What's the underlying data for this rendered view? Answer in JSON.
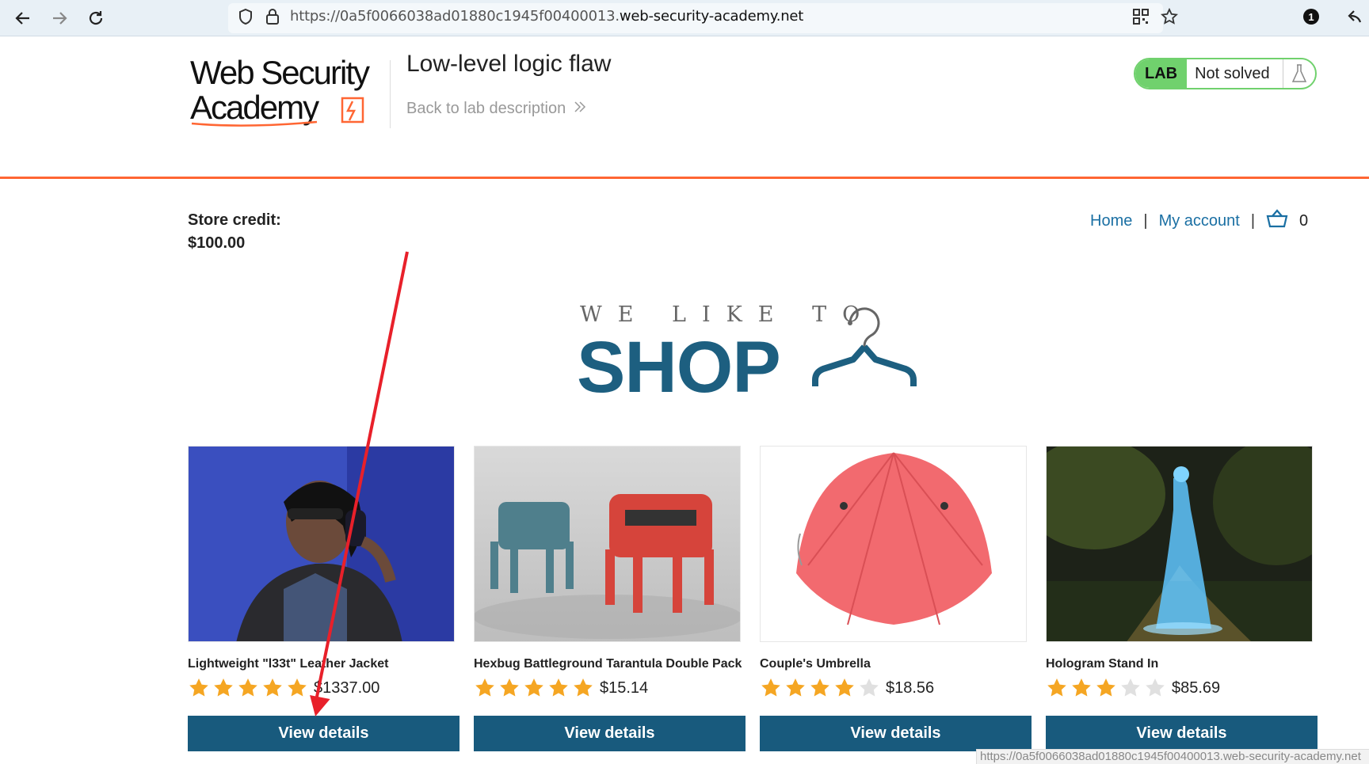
{
  "browser": {
    "url_prefix": "https://0a5f0066038ad01880c1945f00400013.",
    "url_host": "web-security-academy.net",
    "notification_count": "1"
  },
  "lab": {
    "logo_line1": "Web Security",
    "logo_line2": "Academy",
    "title": "Low-level logic flaw",
    "back_link": "Back to lab description",
    "badge": "LAB",
    "status": "Not solved"
  },
  "store": {
    "credit_label": "Store credit:",
    "credit_value": "$100.00",
    "nav": {
      "home": "Home",
      "separator": "|",
      "account": "My account",
      "cart_count": "0"
    }
  },
  "hero": {
    "tagline": "WE LIKE TO",
    "headline": "SHOP"
  },
  "products": [
    {
      "name": "Lightweight \"l33t\" Leather Jacket",
      "rating": 5,
      "price": "$1337.00",
      "button": "View details"
    },
    {
      "name": "Hexbug Battleground Tarantula Double Pack",
      "rating": 5,
      "price": "$15.14",
      "button": "View details"
    },
    {
      "name": "Couple's Umbrella",
      "rating": 4,
      "price": "$18.56",
      "button": "View details"
    },
    {
      "name": "Hologram Stand In",
      "rating": 3,
      "price": "$85.69",
      "button": "View details"
    }
  ],
  "status_bar": {
    "url": "https://0a5f0066038ad01880c1945f00400013.web-security-academy.net"
  },
  "colors": {
    "brand_orange": "#ff6633",
    "lab_green": "#70d16d",
    "button_blue": "#185a7d",
    "link_blue": "#1a6fa3",
    "star": "#f5a623"
  }
}
